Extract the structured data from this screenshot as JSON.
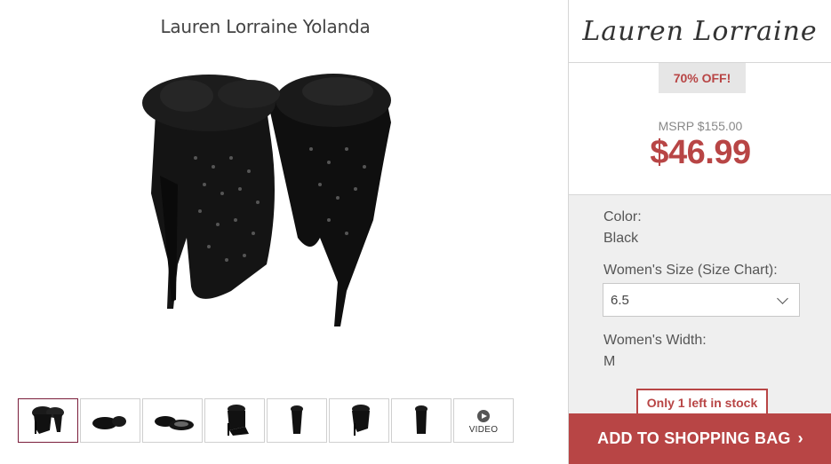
{
  "product": {
    "title": "Lauren Lorraine Yolanda"
  },
  "brand": {
    "logo_text": "Lauren Lorraine"
  },
  "pricing": {
    "discount_badge": "70% OFF!",
    "msrp": "MSRP $155.00",
    "price": "$46.99"
  },
  "options": {
    "color_label": "Color:",
    "color_value": "Black",
    "size_label": "Women's Size (Size Chart):",
    "size_value": "6.5",
    "width_label": "Women's Width:",
    "width_value": "M"
  },
  "stock_notice": "Only 1 left in stock",
  "add_to_bag_label": "ADD TO SHOPPING BAG",
  "thumbnails": {
    "video_label": "VIDEO"
  },
  "colors": {
    "accent_red": "#b84545",
    "selected_border": "#7a1d3a",
    "options_bg": "#efefef"
  }
}
